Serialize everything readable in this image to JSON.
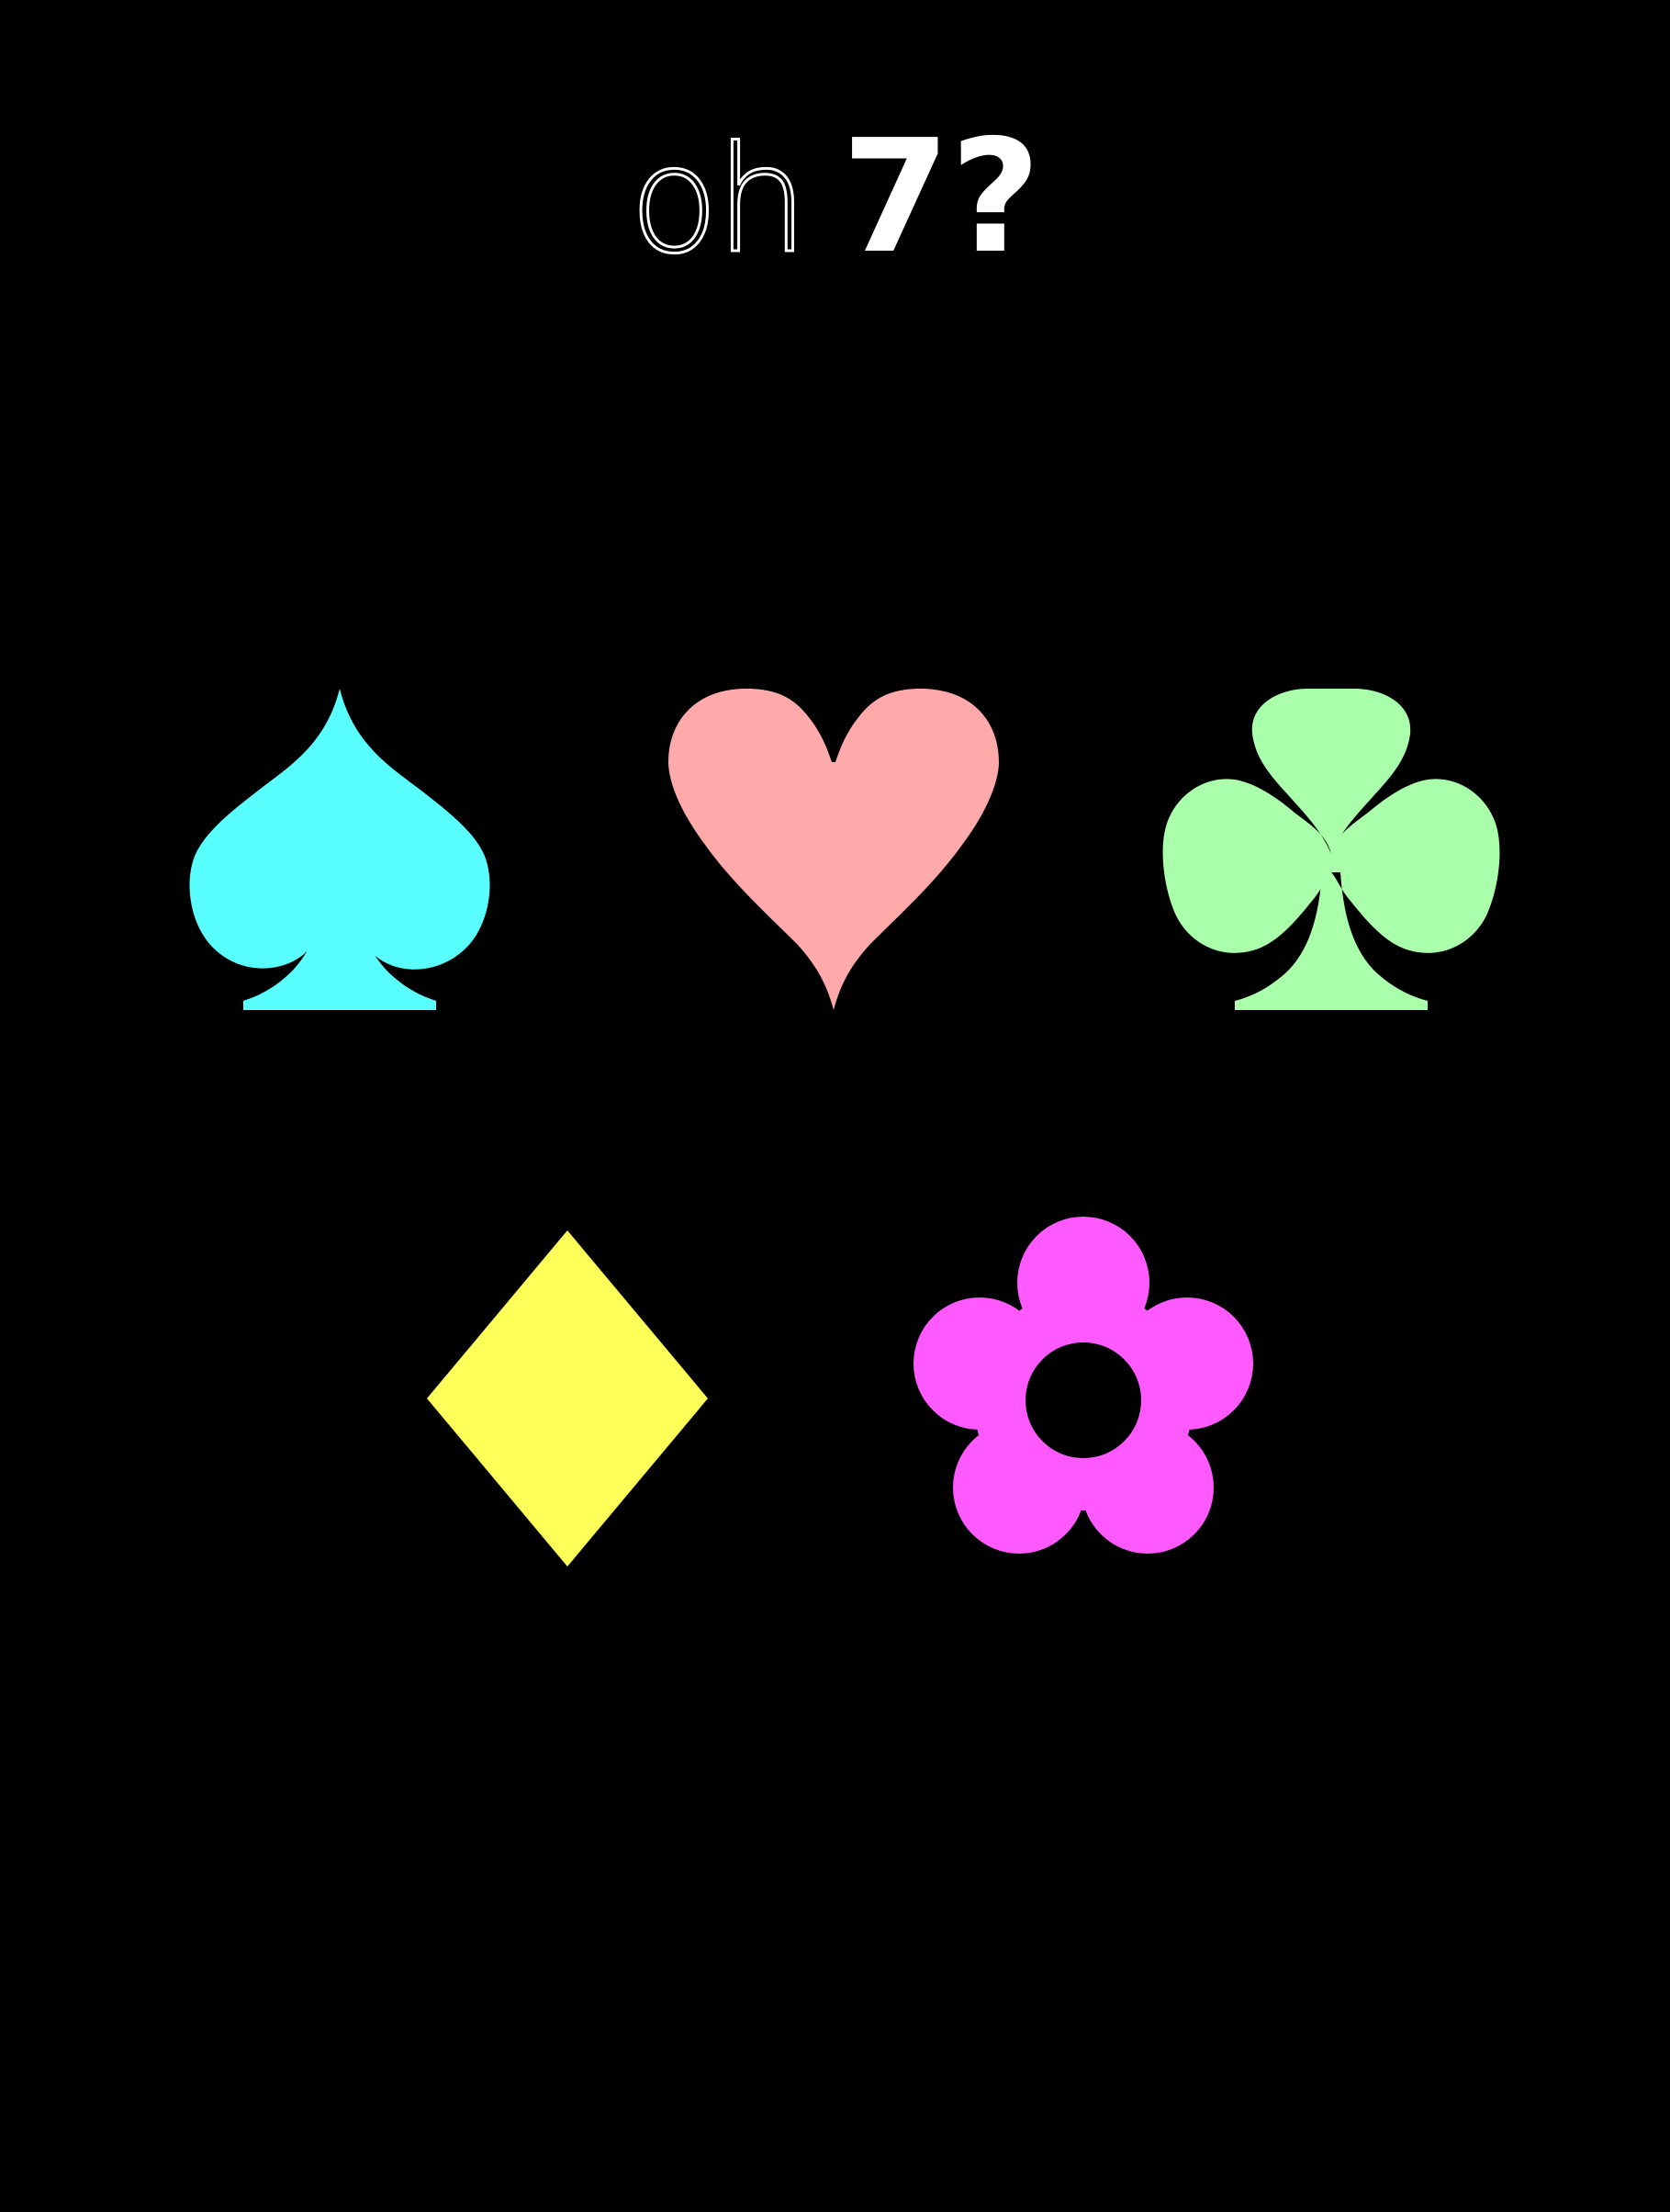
{
  "header": {
    "prefix": "oh",
    "number": "7?"
  },
  "colors": {
    "background": "#000000",
    "title": "#ffffff",
    "spade": "#59ffff",
    "heart": "#ffaaaa",
    "club": "#aaffaa",
    "diamond": "#ffff59",
    "flower": "#ff59ff"
  },
  "choices": [
    {
      "icon": "spade-icon"
    },
    {
      "icon": "heart-icon"
    },
    {
      "icon": "club-icon"
    },
    {
      "icon": "diamond-icon"
    },
    {
      "icon": "flower-icon"
    }
  ]
}
